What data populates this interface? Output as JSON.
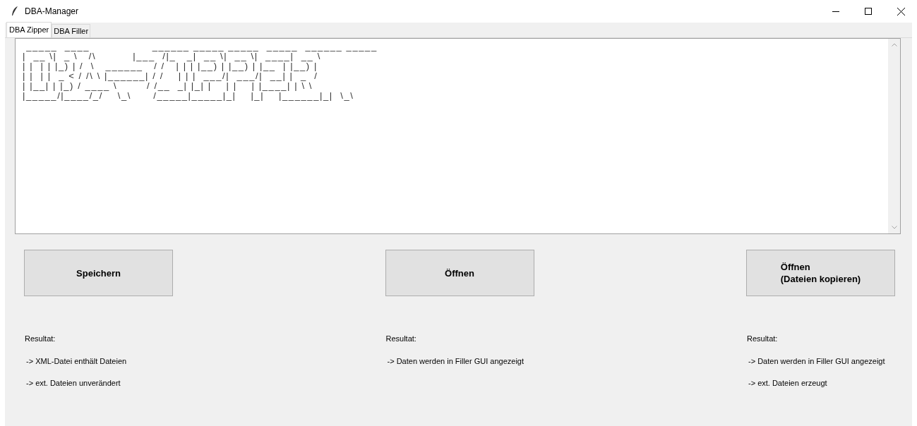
{
  "window": {
    "title": "DBA-Manager"
  },
  "tabs": [
    {
      "label": "DBA Zipper",
      "selected": true
    },
    {
      "label": "DBA Filler",
      "selected": false
    }
  ],
  "banner": {
    "lines": [
      " _____  ____                 ______ _____ _____  _____  ______ _____  ",
      "|  __ \\|  _ \\   /\\          |___  /|_   _|  __ \\|  __ \\|  ____|  __ \\ ",
      "| |  | | |_) | /  \\   ______   / /   | | | |__) | |__) | |__  | |__) |",
      "| |  | |  _ < / /\\ \\ |______| / /    | | |  ___/|  ___/|  __| |  _  / ",
      "| |__| | |_) / ____ \\        / /__  _| |_| |    | |    | |____| | \\ \\ ",
      "|_____/|____/_/    \\_\\      /_____|_____|_|    |_|    |______|_|  \\_\\"
    ]
  },
  "actions": [
    {
      "button": "Speichern",
      "result_title": "Resultat:",
      "results": [
        "-> XML-Datei enthält Dateien",
        "-> ext. Dateien unverändert"
      ]
    },
    {
      "button": "Öffnen",
      "result_title": "Resultat:",
      "results": [
        "-> Daten werden in Filler GUI angezeigt"
      ]
    },
    {
      "button": "Öffnen\n(Dateien kopieren)",
      "result_title": "Resultat:",
      "results": [
        "-> Daten werden in Filler GUI angezeigt",
        "-> ext. Dateien erzeugt"
      ]
    }
  ]
}
